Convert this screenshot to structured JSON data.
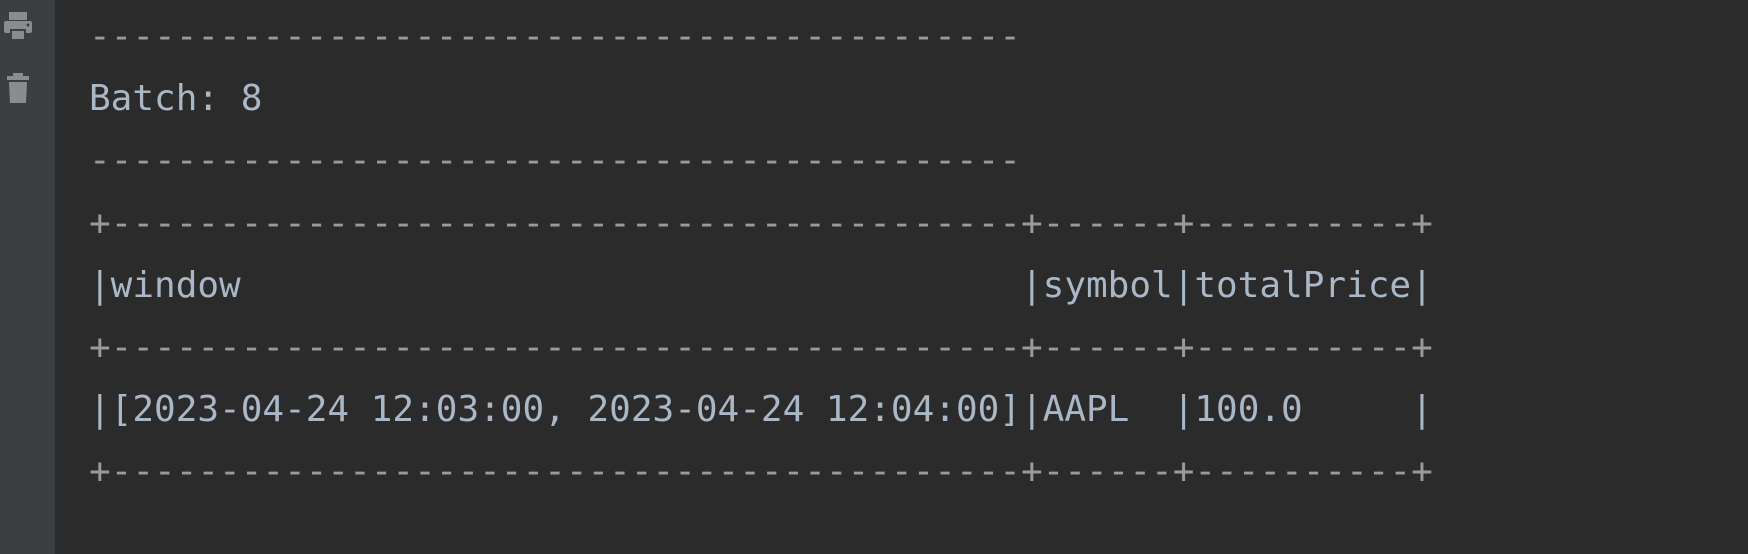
{
  "toolbar": {
    "icons": [
      {
        "name": "print-icon"
      },
      {
        "name": "delete-icon"
      }
    ]
  },
  "console": {
    "lines": [
      "-------------------------------------------",
      "Batch: 8",
      "-------------------------------------------",
      "+------------------------------------------+------+----------+",
      "|window                                    |symbol|totalPrice|",
      "+------------------------------------------+------+----------+",
      "|[2023-04-24 12:03:00, 2023-04-24 12:04:00]|AAPL  |100.0     |",
      "+------------------------------------------+------+----------+"
    ]
  }
}
